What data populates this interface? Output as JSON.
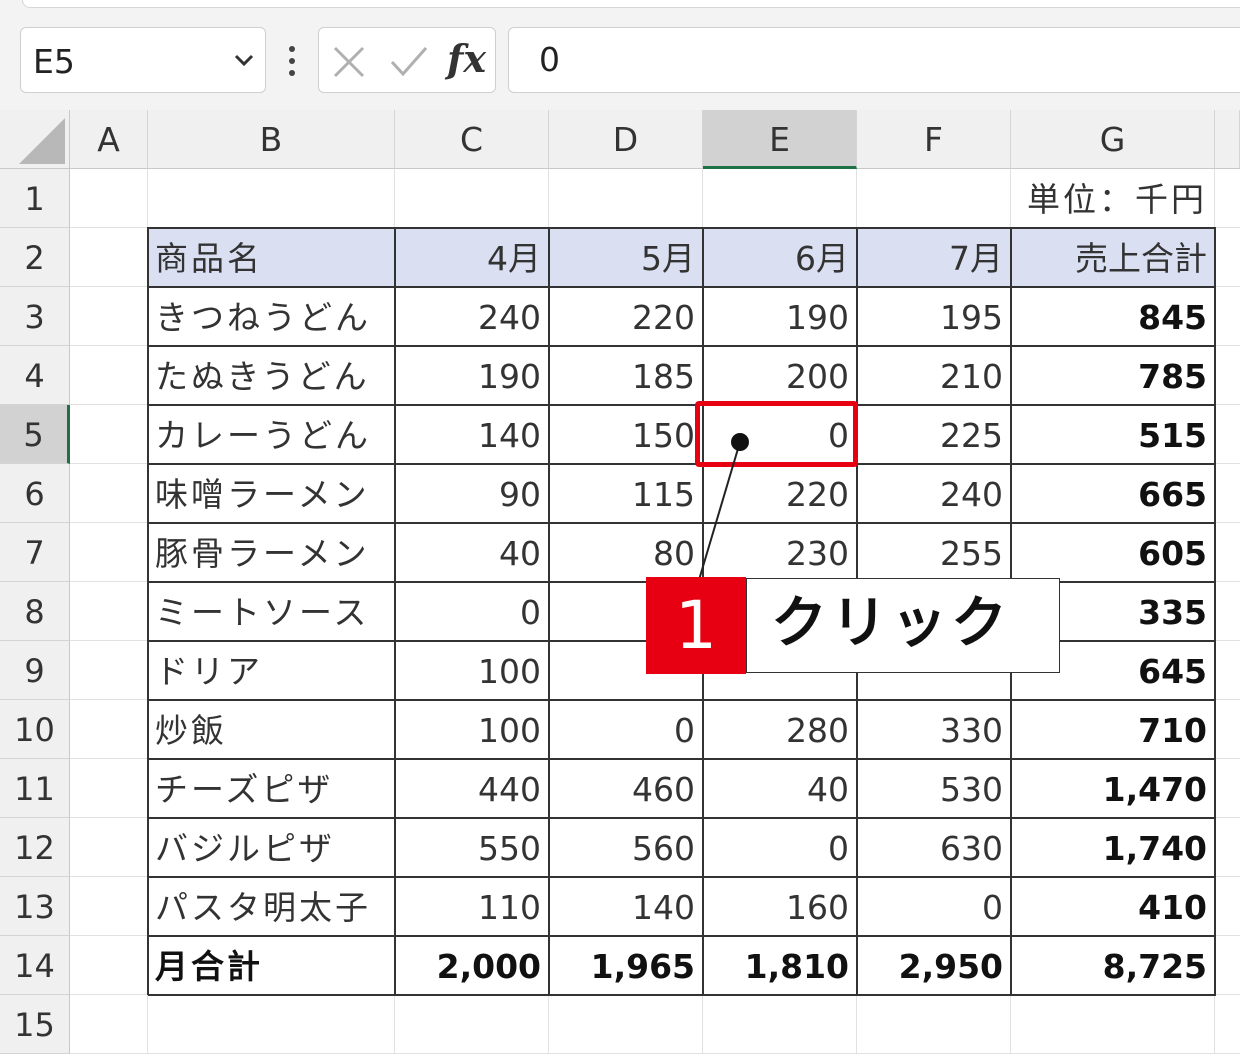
{
  "name_box": {
    "value": "E5"
  },
  "formula_bar": {
    "value": "0"
  },
  "columns": [
    "A",
    "B",
    "C",
    "D",
    "E",
    "F",
    "G"
  ],
  "rows": [
    "1",
    "2",
    "3",
    "4",
    "5",
    "6",
    "7",
    "8",
    "9",
    "10",
    "11",
    "12",
    "13",
    "14",
    "15"
  ],
  "active_cell": {
    "column": "E",
    "row": "5"
  },
  "unit_label": "単位：千円",
  "table": {
    "headers": [
      "商品名",
      "4月",
      "5月",
      "6月",
      "7月",
      "売上合計"
    ],
    "rows": [
      [
        "きつねうどん",
        "240",
        "220",
        "190",
        "195",
        "845"
      ],
      [
        "たぬきうどん",
        "190",
        "185",
        "200",
        "210",
        "785"
      ],
      [
        "カレーうどん",
        "140",
        "150",
        "0",
        "225",
        "515"
      ],
      [
        "味噌ラーメン",
        "90",
        "115",
        "220",
        "240",
        "665"
      ],
      [
        "豚骨ラーメン",
        "40",
        "80",
        "230",
        "255",
        "605"
      ],
      [
        "ミートソース",
        "0",
        "",
        "",
        "",
        "335"
      ],
      [
        "ドリア",
        "100",
        "",
        "",
        "",
        "645"
      ],
      [
        "炒飯",
        "100",
        "0",
        "280",
        "330",
        "710"
      ],
      [
        "チーズピザ",
        "440",
        "460",
        "40",
        "530",
        "1,470"
      ],
      [
        "バジルピザ",
        "550",
        "560",
        "0",
        "630",
        "1,740"
      ],
      [
        "パスタ明太子",
        "110",
        "140",
        "160",
        "0",
        "410"
      ]
    ],
    "total_row": [
      "月合計",
      "2,000",
      "1,965",
      "1,810",
      "2,950",
      "8,725"
    ]
  },
  "annotation": {
    "step_number": "1",
    "label": "クリック",
    "color": "#e60012"
  }
}
